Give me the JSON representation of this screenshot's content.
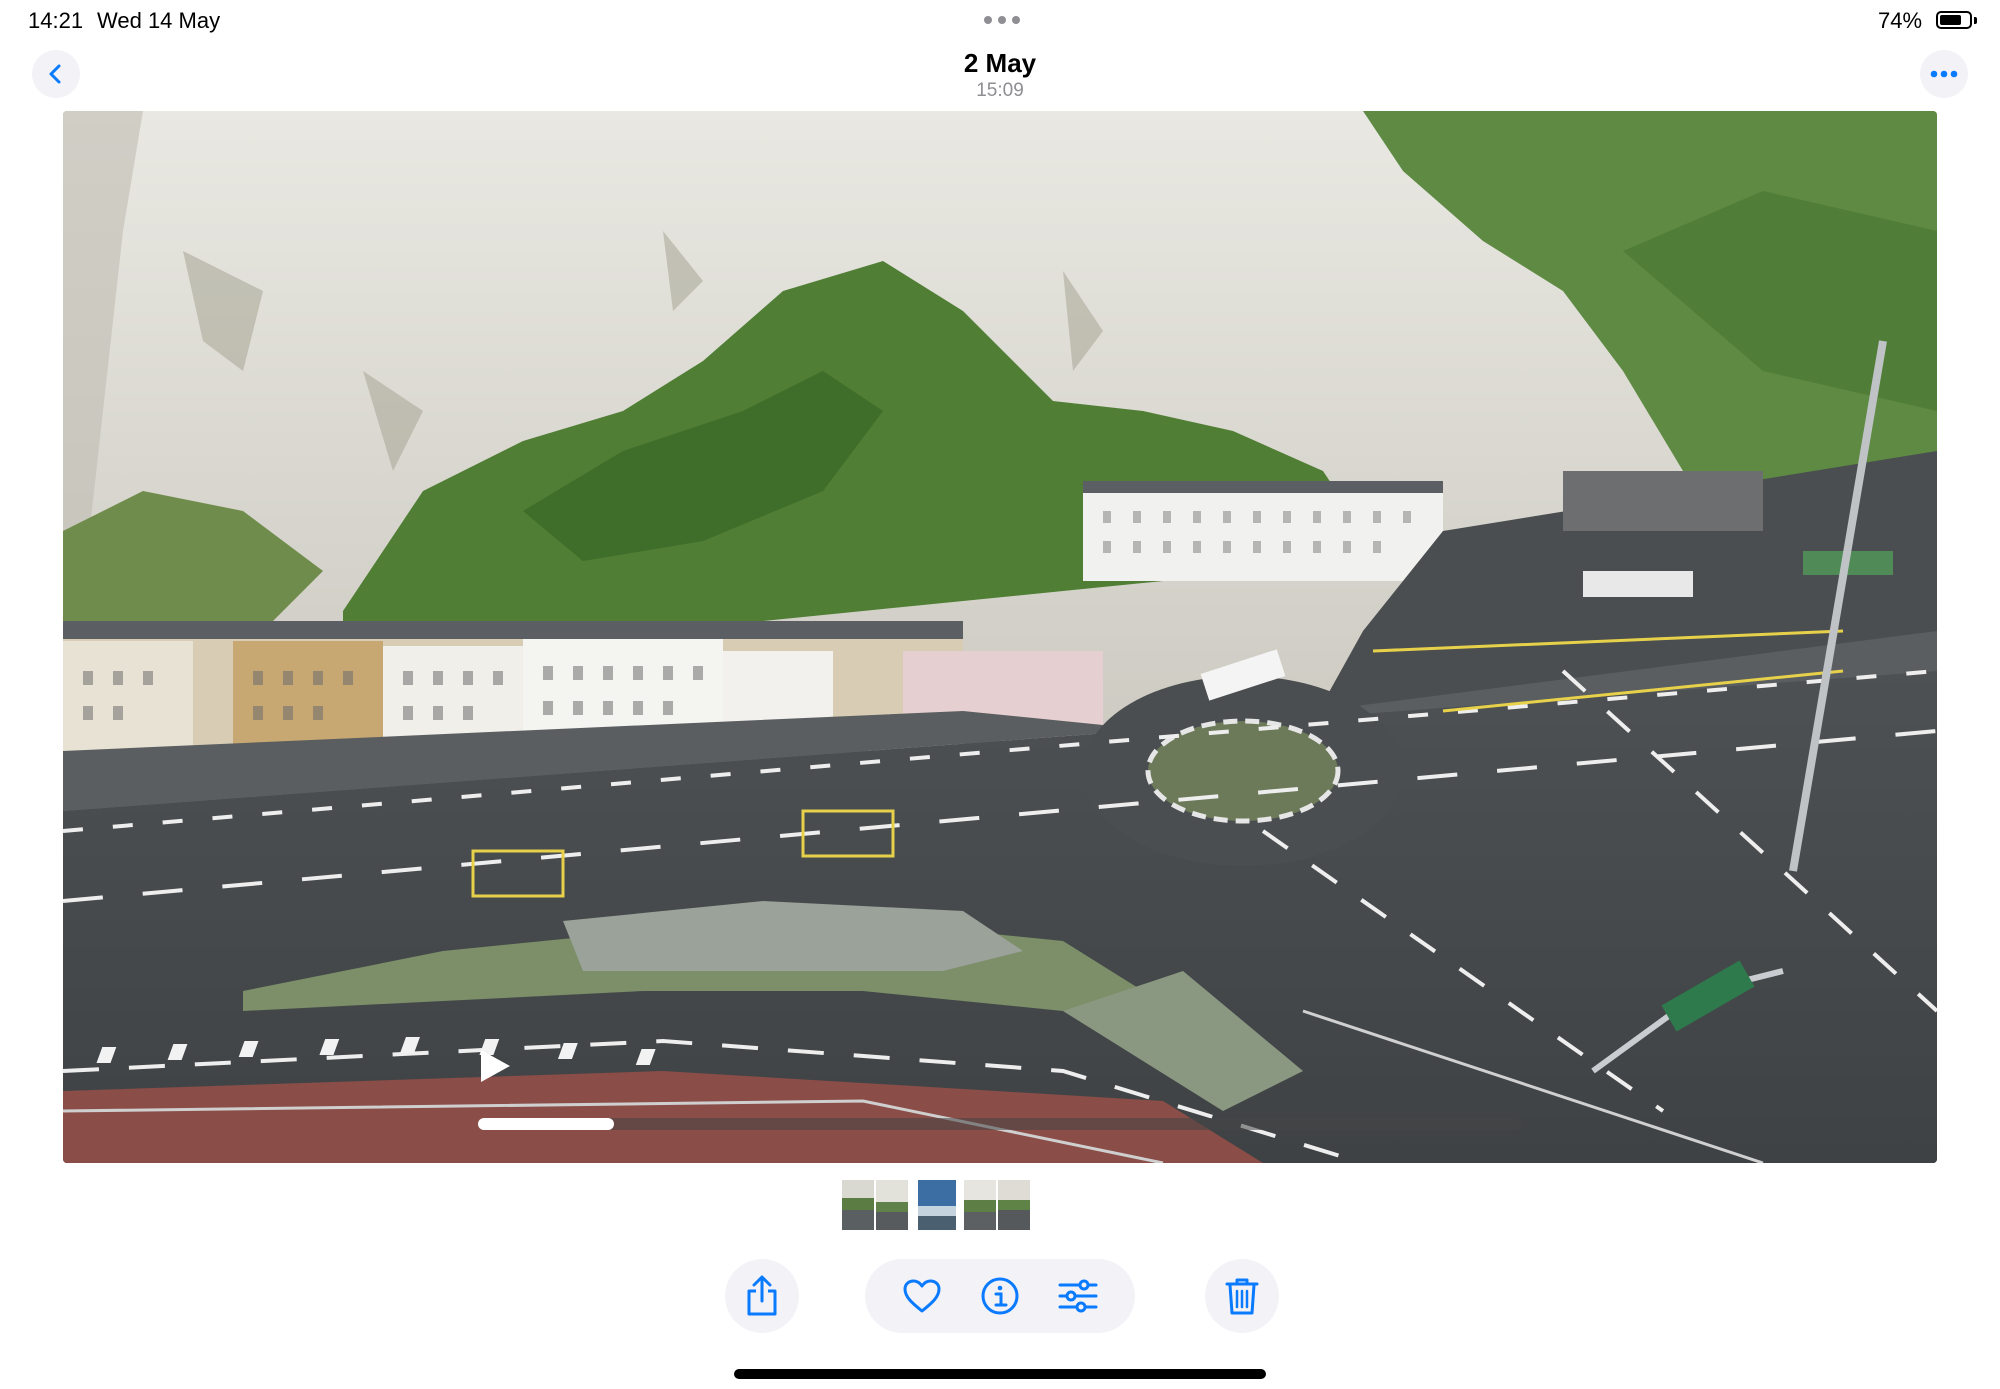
{
  "status_bar": {
    "time": "14:21",
    "date": "Wed 14 May",
    "battery_percent": "74%",
    "battery_level": 0.74
  },
  "header": {
    "title": "2 May",
    "subtitle": "15:09",
    "back_icon": "chevron-left-icon",
    "more_icon": "ellipsis-icon"
  },
  "video": {
    "playback_progress": 0.13,
    "play_icon": "play-icon"
  },
  "filmstrip": {
    "thumbnail_count": 5,
    "selected_index": 2
  },
  "toolbar": {
    "icons": [
      "share-icon",
      "heart-icon",
      "info-icon",
      "adjust-icon",
      "trash-icon"
    ]
  },
  "colors": {
    "accent": "#0a7aff",
    "button_bg": "#f2f2f7",
    "secondary_text": "#8e8e93"
  }
}
